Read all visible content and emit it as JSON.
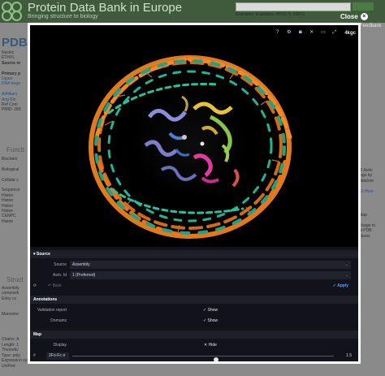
{
  "background": {
    "site_title": "Protein Data Bank in Europe",
    "site_subtitle": "Bringing structure to biology",
    "examples": "Examples: Examples, HPSC-5, 5IDFO",
    "feedback": "Feedback",
    "pdbe_label": "PDBe",
    "left_lines": [
      {
        "t": "Nuclec",
        "c": ""
      },
      {
        "t": "ETHYL",
        "c": ""
      },
      {
        "t": "Source or",
        "c": "b"
      },
      {
        "t": "",
        "c": ""
      },
      {
        "t": "Primary p",
        "c": "b"
      },
      {
        "t": "Ugare",
        "c": "l"
      },
      {
        "t": "DNA targe",
        "c": "l"
      },
      {
        "t": "",
        "c": ""
      },
      {
        "t": "Adhikary",
        "c": "l"
      },
      {
        "t": "Ang Bih",
        "c": "l"
      },
      {
        "t": "Ref Com",
        "c": ""
      },
      {
        "t": "PMID: 280",
        "c": ""
      }
    ],
    "heading_function": "Functi",
    "function_lines": [
      "Biochem",
      "",
      "Biological",
      "",
      "Cellular c",
      "",
      "Sequence",
      "Histon",
      "Histon",
      "Histon",
      "Histon",
      "CENPC",
      "Histon"
    ],
    "heading_structure": "Struct",
    "structure_lines": [
      "Assembly",
      "compositi",
      "Entry co",
      "",
      "",
      "Macromo"
    ],
    "bottom_lines": [
      "Chains: A",
      "Length: 1",
      "Theoretic",
      "Type: poly",
      "Expression system: Escherichia coli",
      "UniProt"
    ],
    "right_lines": [
      {
        "t": "IF Actin",
        "c": ""
      },
      {
        "t": "lego by",
        "c": ""
      },
      {
        "t": "oldatore",
        "c": ""
      },
      {
        "t": "",
        "c": ""
      },
      {
        "t": "51 Hore",
        "c": "l"
      }
    ],
    "right_lines2": [
      {
        "t": "Map",
        "c": ""
      },
      {
        "t": "",
        "c": ""
      },
      {
        "t": "Usage in",
        "c": ""
      },
      {
        "t": "al PDB",
        "c": ""
      },
      {
        "t": "ctures",
        "c": ""
      }
    ]
  },
  "modal": {
    "close_label": "Close",
    "close_icon": "close-circle-icon",
    "toolbar_brand": "4kgc",
    "toolbar_icons": [
      "help-icon",
      "settings-icon",
      "camera-icon",
      "tools-icon",
      "expand-icon",
      "fullscreen-icon"
    ],
    "toolbar_glyphs": [
      "?",
      "⚙",
      "◙",
      "✕",
      "▭",
      "⤢"
    ]
  },
  "panel": {
    "source_section": "Source",
    "source_label": "Source",
    "source_value": "Assembly",
    "asm_label": "Asm. Id",
    "asm_value": "1 (Preferred)",
    "back_label": "Back",
    "apply_label": "Apply",
    "annotations_section": "Annotations",
    "validation_label": "Validation report",
    "validation_value": "Show",
    "domains_label": "Domains",
    "domains_value": "Show",
    "map_section": "Map",
    "display_label": "Display",
    "display_value": "Hide",
    "map_type": "2Fo-Fc σ",
    "map_sigma": "1.5",
    "map_sigma_fraction": 0.55,
    "colors": {
      "accent": "#5aa1ff",
      "panel_bg": "#12131a",
      "section_bg": "#1d1f29"
    }
  }
}
